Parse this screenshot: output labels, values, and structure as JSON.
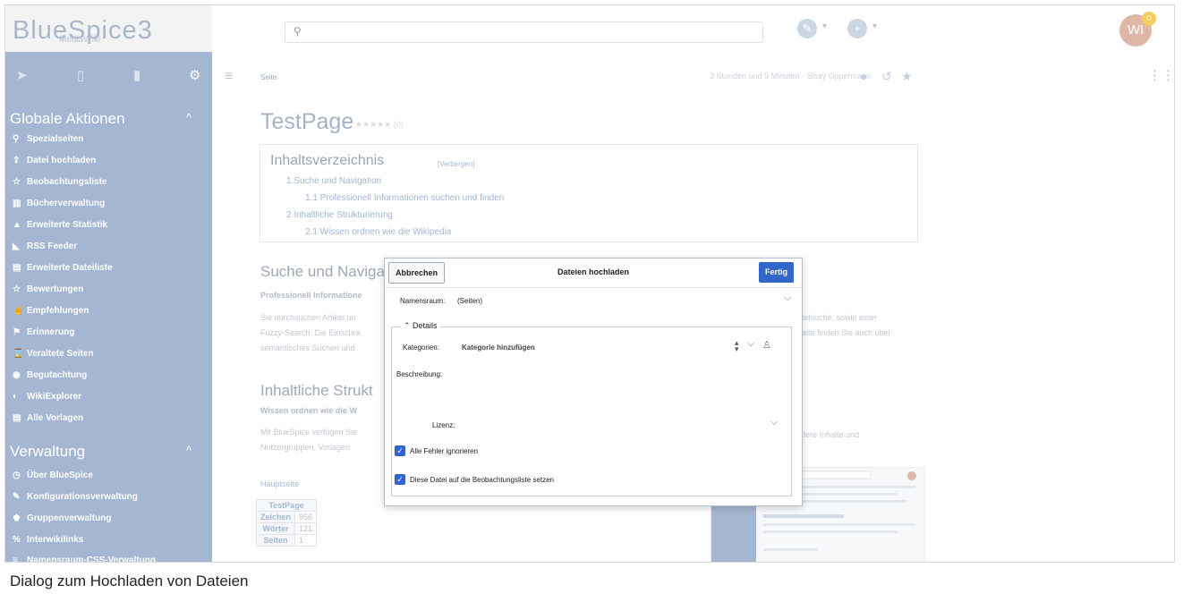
{
  "header": {
    "logo_text": "BlueSpice3",
    "logo_subtitle": "MediaWiki",
    "search_icon": "⚲",
    "avatar_initials": "WI",
    "avatar_badge": "☺",
    "edit_icon": "✎",
    "add_icon": "+",
    "caret": "▾"
  },
  "sidebar": {
    "tools": [
      "➤",
      "▯",
      "▮",
      "⚙"
    ],
    "section1": {
      "title": "Globale Aktionen",
      "chevron": "^"
    },
    "global_items": [
      {
        "icon": "⚲",
        "label": "Spezialseiten"
      },
      {
        "icon": "⇪",
        "label": "Datei hochladen"
      },
      {
        "icon": "☆",
        "label": "Beobachtungsliste"
      },
      {
        "icon": "▥",
        "label": "Bücherverwaltung"
      },
      {
        "icon": "▲",
        "label": "Erweiterte Statistik"
      },
      {
        "icon": "◣",
        "label": "RSS Feeder"
      },
      {
        "icon": "▤",
        "label": "Erweiterte Dateiliste"
      },
      {
        "icon": "☆",
        "label": "Bewertungen"
      },
      {
        "icon": "☝",
        "label": "Empfehlungen"
      },
      {
        "icon": "⚑",
        "label": "Erinnerung"
      },
      {
        "icon": "⌛",
        "label": "Veraltete Seiten"
      },
      {
        "icon": "◉",
        "label": "Begutachtung"
      },
      {
        "icon": "◐",
        "label": "WikiExplorer"
      },
      {
        "icon": "▤",
        "label": "Alle Vorlagen"
      }
    ],
    "section2": {
      "title": "Verwaltung",
      "chevron": "^"
    },
    "admin_items": [
      {
        "icon": "◷",
        "label": "Über BlueSpice"
      },
      {
        "icon": "✎",
        "label": "Konfigurationsverwaltung"
      },
      {
        "icon": "♚",
        "label": "Gruppenverwaltung"
      },
      {
        "icon": "%",
        "label": "Interwikilinks"
      },
      {
        "icon": "≡",
        "label": "Namensraum-CSS-Verwaltung"
      }
    ]
  },
  "page": {
    "hamburger": "≡",
    "breadcrumb": "Seite",
    "meta": "3 Stunden und 9 Minuten - Sissy Oppermann",
    "meta_icons": [
      "●",
      "↺",
      "★"
    ],
    "grid_icon": "⋮⋮⋮",
    "title": "TestPage",
    "stars": "★★★★★ (0)",
    "toc": {
      "title": "Inhaltsverzeichnis",
      "hide": "[Verbergen]",
      "items": [
        "1   Suche und Navigation",
        "1.1   Professionell Informationen suchen und finden",
        "2   Inhaltliche Strukturierung",
        "2.1   Wissen ordnen wie die Wikipedia"
      ]
    },
    "h2_1": "Suche und Naviga",
    "h3_1": "Professionell Informatione",
    "p1_left": [
      "Sie durchsuchen Artikel un",
      "Fuzzy-Search. Die Einschrä",
      "semantisches Suchen und"
    ],
    "p1_right": [
      "telsuche, sowie einer",
      "alte finden Sie auch über"
    ],
    "h2_2": "Inhaltliche Strukt",
    "h3_2": "Wissen ordnen wie die W",
    "p2_left": [
      "Mit BlueSpice verfügen Sie",
      "Nutzergruppen, Vorlagen"
    ],
    "p2_right": [
      "ndere Inhalte und"
    ],
    "link": "Hauptseite",
    "table": {
      "header": "TestPage",
      "rows": [
        [
          "Zeichen",
          "956"
        ],
        [
          "Wörter",
          "121"
        ],
        [
          "Seiten",
          "1"
        ]
      ]
    }
  },
  "dialog": {
    "cancel": "Abbrechen",
    "title": "Dateien hochladen",
    "done": "Fertig",
    "namespace_label": "Namensraum:",
    "namespace_value": "(Seiten)",
    "details_legend": "Details",
    "categories_label": "Kategorien:",
    "categories_value": "Kategorie hinzufügen",
    "description_label": "Beschreibung:",
    "license_label": "Lizenz:",
    "checkbox1": "Alle Fehler ignorieren",
    "checkbox2": "Diese Datei auf die Beobachtungsliste setzen",
    "chevron": "⌵",
    "check": "✓",
    "tree_icon": "♙"
  },
  "caption": "Dialog zum Hochladen von Dateien"
}
